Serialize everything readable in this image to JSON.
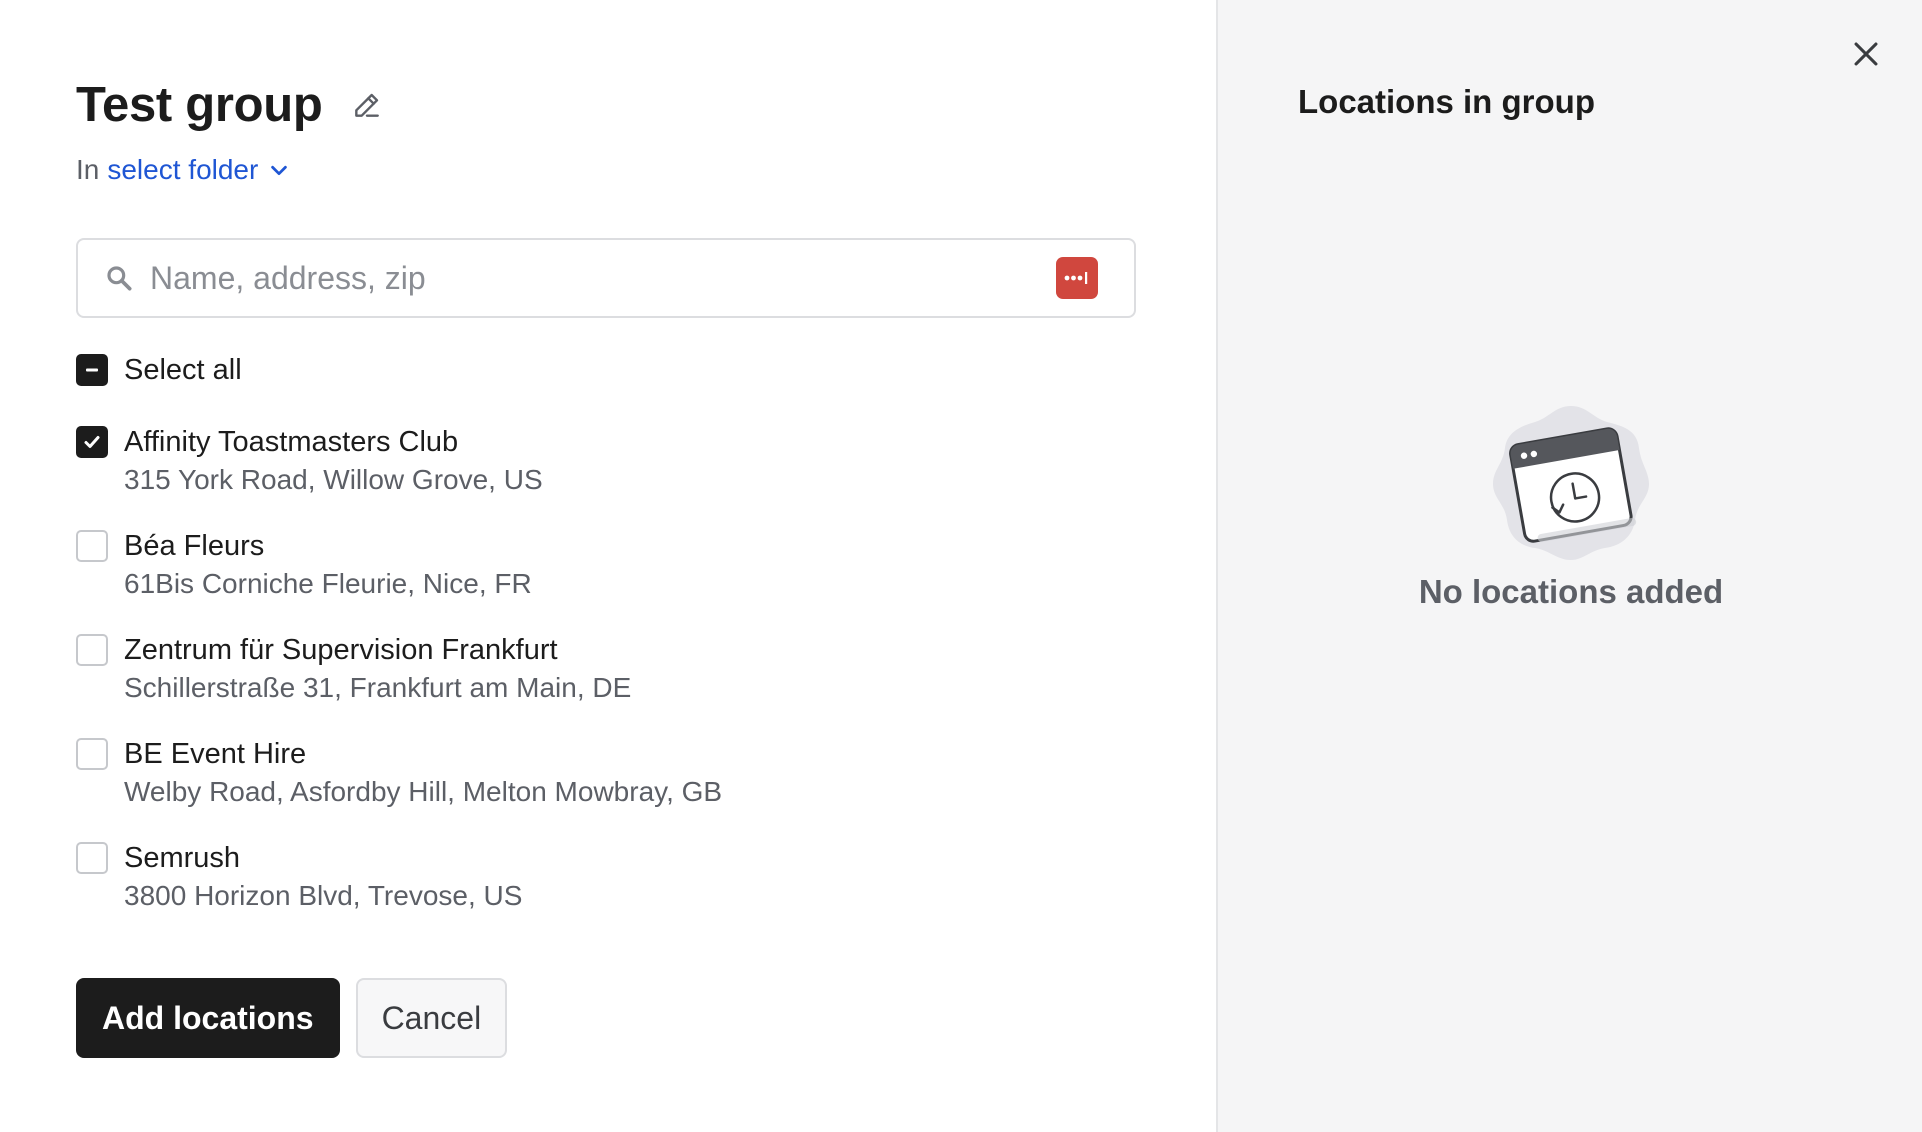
{
  "left": {
    "title": "Test group",
    "edit_icon": "pencil-icon",
    "folder_prefix": "In",
    "folder_link": "select folder",
    "folder_chevron_icon": "chevron-down-icon",
    "search": {
      "placeholder": "Name, address, zip",
      "value": "",
      "icon": "search-icon",
      "password_manager_icon": "password-manager-icon",
      "password_manager_color": "#d0473e"
    },
    "select_all": {
      "label": "Select all",
      "state": "indeterminate"
    },
    "locations": [
      {
        "name": "Affinity Toastmasters Club",
        "address": "315 York Road, Willow Grove, US",
        "checked": true
      },
      {
        "name": "Béa Fleurs",
        "address": "61Bis Corniche Fleurie, Nice, FR",
        "checked": false
      },
      {
        "name": "Zentrum für Supervision Frankfurt",
        "address": "Schillerstraße 31, Frankfurt am Main, DE",
        "checked": false
      },
      {
        "name": "BE Event Hire",
        "address": "Welby Road, Asfordby Hill, Melton Mowbray, GB",
        "checked": false
      },
      {
        "name": "Semrush",
        "address": "3800 Horizon Blvd, Trevose, US",
        "checked": false
      }
    ],
    "actions": {
      "primary_label": "Add locations",
      "secondary_label": "Cancel"
    }
  },
  "right": {
    "title": "Locations in group",
    "close_icon": "close-icon",
    "empty_icon": "browser-clock-icon",
    "empty_text": "No locations added"
  },
  "colors": {
    "accent_link": "#1f56d4",
    "primary_button": "#1c1c1c",
    "panel_bg": "#f5f5f6",
    "muted_text": "#5c5f66"
  }
}
